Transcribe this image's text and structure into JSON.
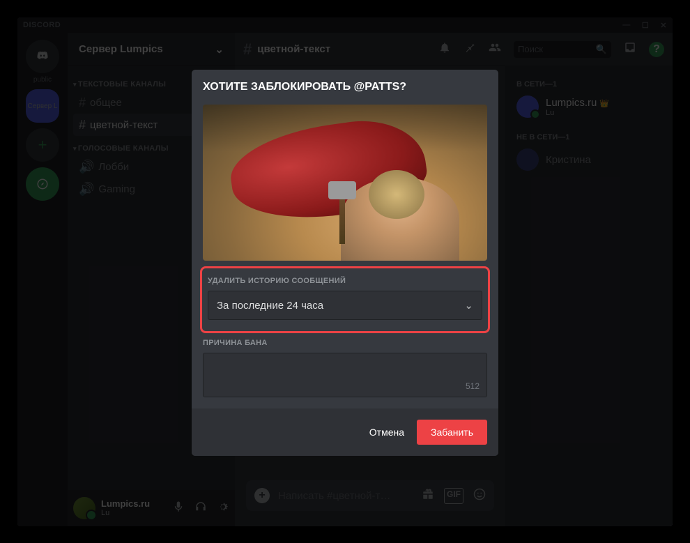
{
  "titlebar": {
    "brand": "DISCORD"
  },
  "servers": {
    "home_label": "public",
    "selected": "Сервер L"
  },
  "server_header": {
    "name": "Сервер Lumpics"
  },
  "channel_categories": [
    {
      "label": "ТЕКСТОВЫЕ КАНАЛЫ",
      "channels": [
        {
          "name": "общее",
          "type": "text"
        },
        {
          "name": "цветной-текст",
          "type": "text",
          "active": true
        }
      ]
    },
    {
      "label": "ГОЛОСОВЫЕ КАНАЛЫ",
      "channels": [
        {
          "name": "Лобби",
          "type": "voice"
        },
        {
          "name": "Gaming",
          "type": "voice"
        }
      ]
    }
  ],
  "current_channel": "цветной-текст",
  "search": {
    "placeholder": "Поиск"
  },
  "user_panel": {
    "name": "Lumpics.ru",
    "tag": "Lu"
  },
  "message_input": {
    "placeholder": "Написать #цветной-т…"
  },
  "members": {
    "online_header": "В СЕТИ—1",
    "offline_header": "НЕ В СЕТИ—1",
    "online": [
      {
        "name": "Lumpics.ru",
        "sub": "Lu",
        "owner": true
      }
    ],
    "offline": [
      {
        "name": "Кристина"
      }
    ]
  },
  "modal": {
    "title": "ХОТИТЕ ЗАБЛОКИРОВАТЬ @PATTS?",
    "delete_history_label": "УДАЛИТЬ ИСТОРИЮ СООБЩЕНИЙ",
    "delete_history_value": "За последние 24 часа",
    "reason_label": "ПРИЧИНА БАНА",
    "char_limit": "512",
    "cancel": "Отмена",
    "ban": "Забанить"
  }
}
